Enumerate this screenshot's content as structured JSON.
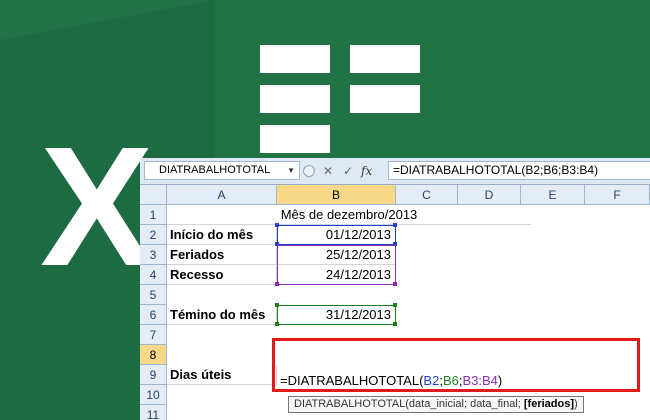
{
  "colors": {
    "excel_green": "#217346",
    "highlight_red": "#e11b1b",
    "header_active": "#f8d98a"
  },
  "logo": {
    "icon": "excel-logo-icon"
  },
  "formula_bar": {
    "name_box": "DIATRABALHOTOTAL",
    "name_box_arrow": "▼",
    "cancel_icon": "✕",
    "enter_icon": "✓",
    "fx_label": "fx",
    "formula": "=DIATRABALHOTOTAL(B2;B6;B3:B4)"
  },
  "columns": [
    "A",
    "B",
    "C",
    "D",
    "E",
    "F"
  ],
  "rows": [
    "1",
    "2",
    "3",
    "4",
    "5",
    "6",
    "7",
    "8",
    "9",
    "10",
    "11"
  ],
  "cells": {
    "B1": "Mês de dezembro/2013",
    "A2": "Início do mês",
    "B2": "01/12/2013",
    "A3": "Feriados",
    "B3": "25/12/2013",
    "A4": "Recesso",
    "B4": "24/12/2013",
    "A6": "Témino do mês",
    "B6": "31/12/2013",
    "A8": "Dias úteis"
  },
  "editing": {
    "prefix": "=DIATRABALHOTOTAL(",
    "arg1": "B2",
    "sep1": ";",
    "arg2": "B6",
    "sep2": ";",
    "arg3": "B3:B4",
    "suffix": ")"
  },
  "tooltip": {
    "func": "DIATRABALHOTOTAL(",
    "args": "data_inicial; data_final; ",
    "current": "[feriados]",
    "close": ")"
  }
}
